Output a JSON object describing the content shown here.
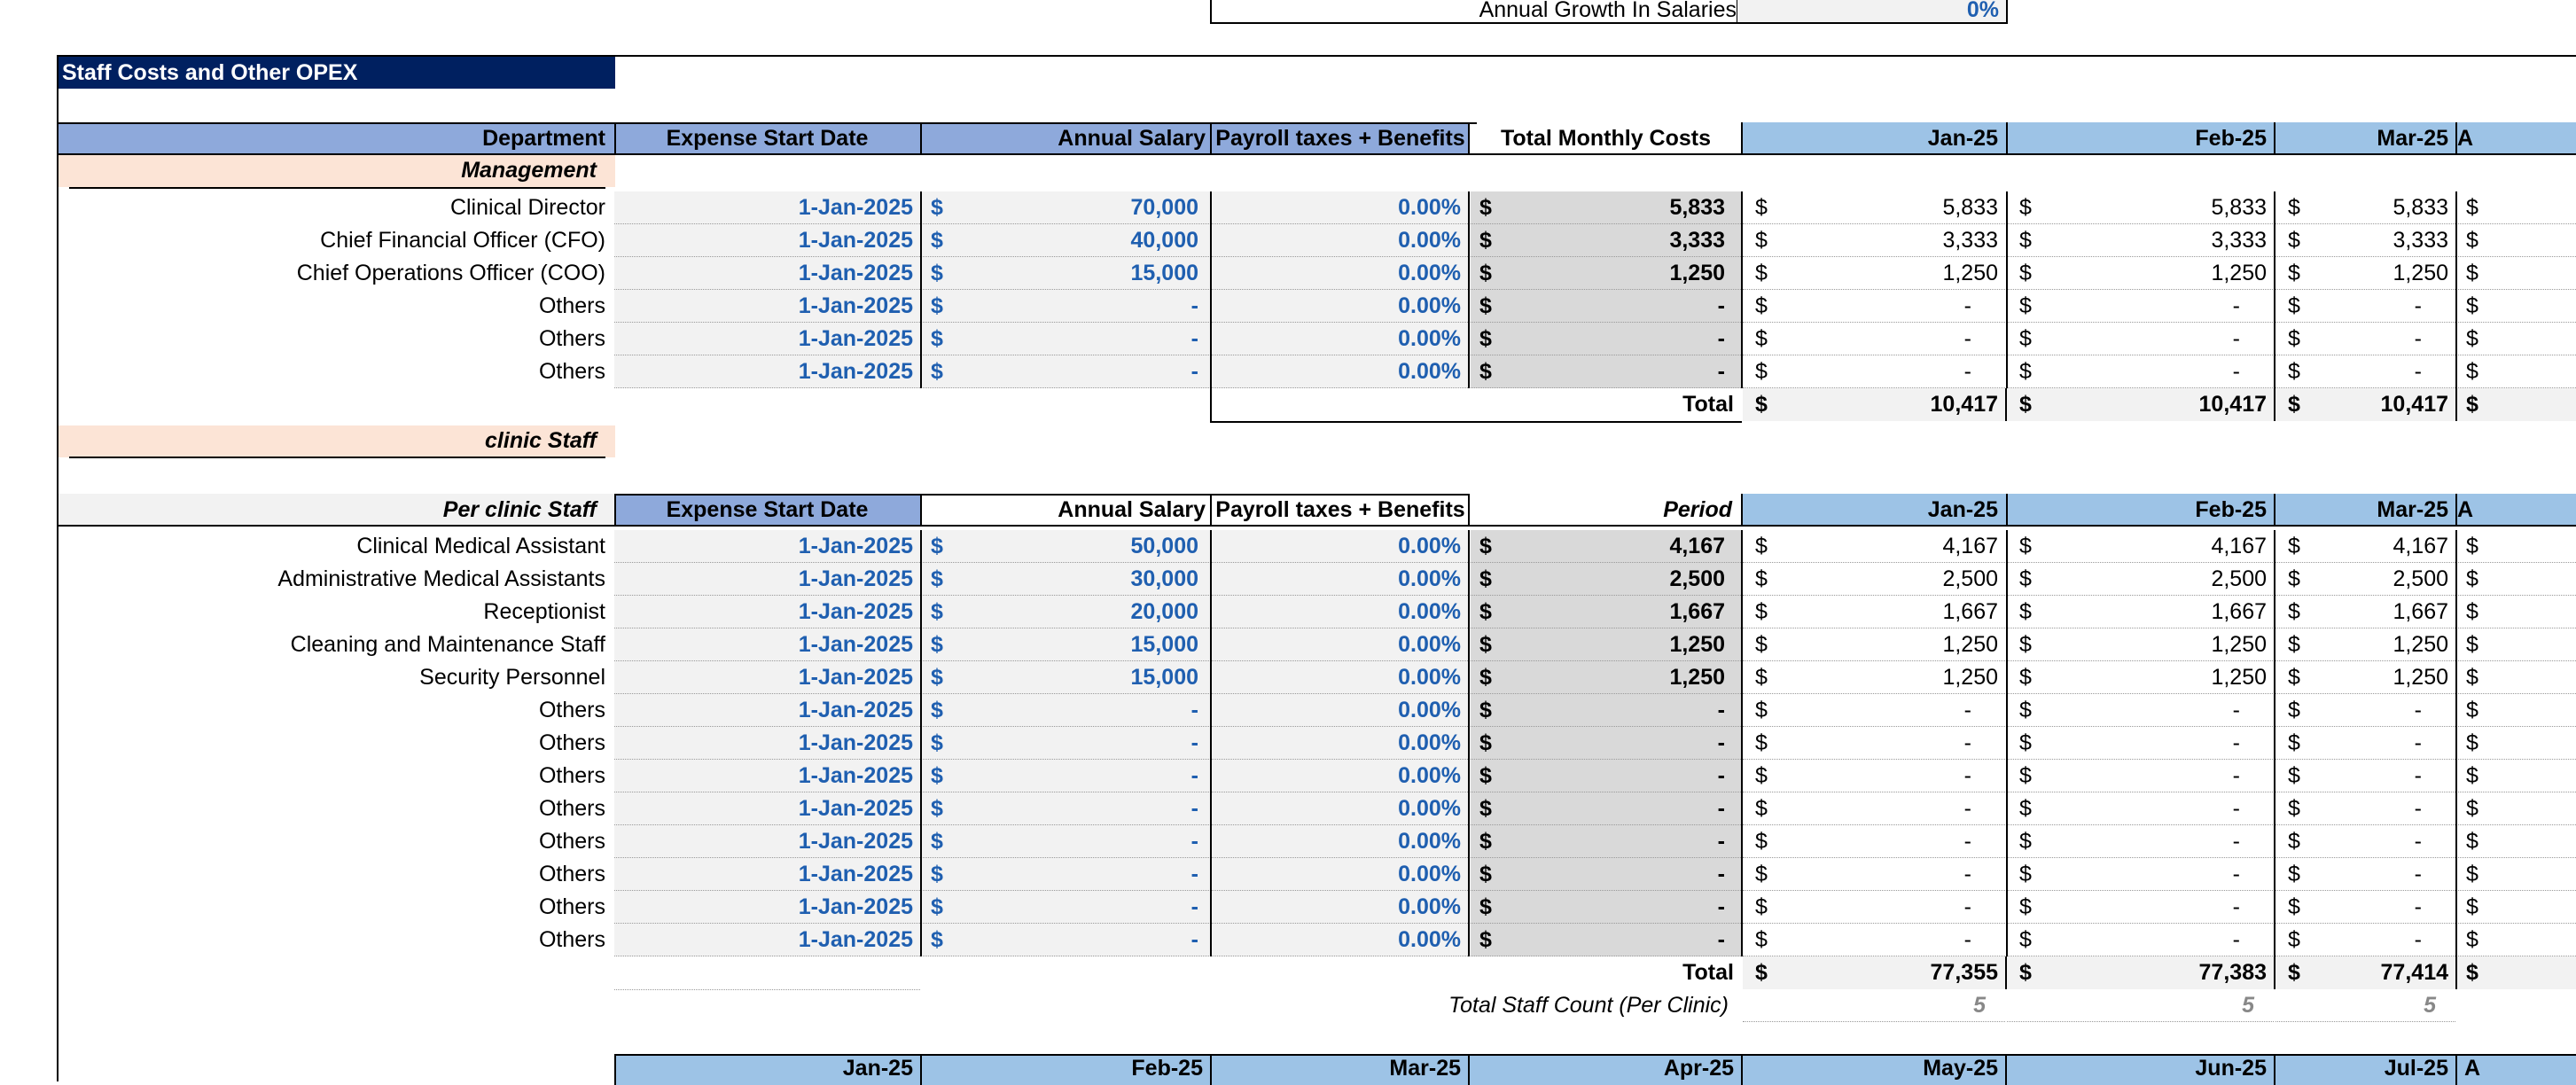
{
  "growth": {
    "label": "Annual Growth In Salaries",
    "value": "0%"
  },
  "section_title": "Staff Costs and Other OPEX",
  "months": [
    "Jan-25",
    "Feb-25",
    "Mar-25"
  ],
  "currency": "$",
  "dash": "-",
  "management": {
    "headers": {
      "department": "Department",
      "start": "Expense Start Date",
      "salary": "Annual Salary",
      "payroll": "Payroll taxes + Benefits",
      "total": "Total Monthly Costs"
    },
    "group_label": "Management",
    "rows": [
      {
        "name": "Clinical Director",
        "start": "1-Jan-2025",
        "salary": "70,000",
        "payroll": "0.00%",
        "monthly": "5,833",
        "m": [
          "5,833",
          "5,833",
          "5,833"
        ]
      },
      {
        "name": "Chief Financial Officer (CFO)",
        "start": "1-Jan-2025",
        "salary": "40,000",
        "payroll": "0.00%",
        "monthly": "3,333",
        "m": [
          "3,333",
          "3,333",
          "3,333"
        ]
      },
      {
        "name": "Chief Operations Officer (COO)",
        "start": "1-Jan-2025",
        "salary": "15,000",
        "payroll": "0.00%",
        "monthly": "1,250",
        "m": [
          "1,250",
          "1,250",
          "1,250"
        ]
      },
      {
        "name": "Others",
        "start": "1-Jan-2025",
        "salary": "-",
        "payroll": "0.00%",
        "monthly": "-",
        "m": [
          "-",
          "-",
          "-"
        ]
      },
      {
        "name": "Others",
        "start": "1-Jan-2025",
        "salary": "-",
        "payroll": "0.00%",
        "monthly": "-",
        "m": [
          "-",
          "-",
          "-"
        ]
      },
      {
        "name": "Others",
        "start": "1-Jan-2025",
        "salary": "-",
        "payroll": "0.00%",
        "monthly": "-",
        "m": [
          "-",
          "-",
          "-"
        ]
      }
    ],
    "total_label": "Total",
    "totals": [
      "10,417",
      "10,417",
      "10,417"
    ]
  },
  "clinic_label": "clinic Staff",
  "clinic": {
    "headers": {
      "department": "Per clinic Staff",
      "start": "Expense Start Date",
      "salary": "Annual Salary",
      "payroll": "Payroll taxes + Benefits",
      "total": "Period"
    },
    "rows": [
      {
        "name": "Clinical Medical Assistant",
        "start": "1-Jan-2025",
        "salary": "50,000",
        "payroll": "0.00%",
        "monthly": "4,167",
        "m": [
          "4,167",
          "4,167",
          "4,167"
        ]
      },
      {
        "name": "Administrative Medical Assistants",
        "start": "1-Jan-2025",
        "salary": "30,000",
        "payroll": "0.00%",
        "monthly": "2,500",
        "m": [
          "2,500",
          "2,500",
          "2,500"
        ]
      },
      {
        "name": "Receptionist",
        "start": "1-Jan-2025",
        "salary": "20,000",
        "payroll": "0.00%",
        "monthly": "1,667",
        "m": [
          "1,667",
          "1,667",
          "1,667"
        ]
      },
      {
        "name": "Cleaning and Maintenance Staff",
        "start": "1-Jan-2025",
        "salary": "15,000",
        "payroll": "0.00%",
        "monthly": "1,250",
        "m": [
          "1,250",
          "1,250",
          "1,250"
        ]
      },
      {
        "name": "Security Personnel",
        "start": "1-Jan-2025",
        "salary": "15,000",
        "payroll": "0.00%",
        "monthly": "1,250",
        "m": [
          "1,250",
          "1,250",
          "1,250"
        ]
      },
      {
        "name": "Others",
        "start": "1-Jan-2025",
        "salary": "-",
        "payroll": "0.00%",
        "monthly": "-",
        "m": [
          "-",
          "-",
          "-"
        ]
      },
      {
        "name": "Others",
        "start": "1-Jan-2025",
        "salary": "-",
        "payroll": "0.00%",
        "monthly": "-",
        "m": [
          "-",
          "-",
          "-"
        ]
      },
      {
        "name": "Others",
        "start": "1-Jan-2025",
        "salary": "-",
        "payroll": "0.00%",
        "monthly": "-",
        "m": [
          "-",
          "-",
          "-"
        ]
      },
      {
        "name": "Others",
        "start": "1-Jan-2025",
        "salary": "-",
        "payroll": "0.00%",
        "monthly": "-",
        "m": [
          "-",
          "-",
          "-"
        ]
      },
      {
        "name": "Others",
        "start": "1-Jan-2025",
        "salary": "-",
        "payroll": "0.00%",
        "monthly": "-",
        "m": [
          "-",
          "-",
          "-"
        ]
      },
      {
        "name": "Others",
        "start": "1-Jan-2025",
        "salary": "-",
        "payroll": "0.00%",
        "monthly": "-",
        "m": [
          "-",
          "-",
          "-"
        ]
      },
      {
        "name": "Others",
        "start": "1-Jan-2025",
        "salary": "-",
        "payroll": "0.00%",
        "monthly": "-",
        "m": [
          "-",
          "-",
          "-"
        ]
      },
      {
        "name": "Others",
        "start": "1-Jan-2025",
        "salary": "-",
        "payroll": "0.00%",
        "monthly": "-",
        "m": [
          "-",
          "-",
          "-"
        ]
      }
    ],
    "total_label": "Total",
    "totals": [
      "77,355",
      "77,383",
      "77,414"
    ],
    "count_label": "Total Staff Count (Per Clinic)",
    "counts": [
      "5",
      "5",
      "5"
    ]
  },
  "bottom_months": [
    "Jan-25",
    "Feb-25",
    "Mar-25",
    "Apr-25",
    "May-25",
    "Jun-25",
    "Jul-25"
  ]
}
